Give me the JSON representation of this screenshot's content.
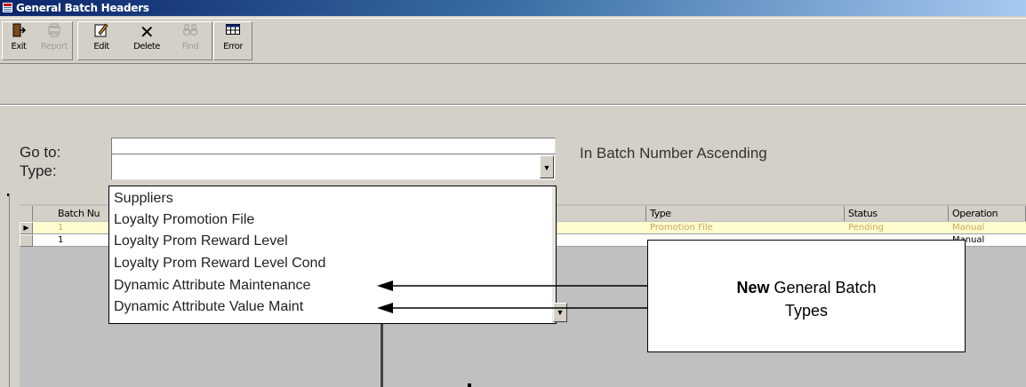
{
  "window": {
    "title": "General Batch Headers"
  },
  "toolbar": {
    "buttons": [
      {
        "label": "Exit",
        "icon": "exit-door-icon",
        "enabled": true
      },
      {
        "label": "Report",
        "icon": "report-icon",
        "enabled": false
      },
      {
        "label": "Edit",
        "icon": "edit-icon",
        "enabled": true
      },
      {
        "label": "Delete",
        "icon": "delete-x-icon",
        "enabled": true
      },
      {
        "label": "Find",
        "icon": "binoculars-icon",
        "enabled": false
      },
      {
        "label": "Error",
        "icon": "grid-icon",
        "enabled": true
      }
    ]
  },
  "form": {
    "goto_label": "Go to:",
    "goto_value": "",
    "sort_text": "In Batch Number Ascending",
    "type_label": "Type:",
    "type_value": ""
  },
  "type_dropdown": {
    "options": [
      "Suppliers",
      "Loyalty Promotion File",
      "Loyalty Prom Reward Level",
      "Loyalty Prom Reward Level Cond",
      "Dynamic Attribute Maintenance",
      "Dynamic Attribute Value Maint"
    ]
  },
  "grid": {
    "columns": [
      "Batch Nu",
      "Type",
      "Status",
      "Operation"
    ],
    "rows": [
      {
        "batch": "1",
        "type": "Promotion File",
        "status": "Pending",
        "operation": "Manual",
        "selected": true
      },
      {
        "batch": "1",
        "type": "",
        "status": "",
        "operation": "Manual",
        "selected": false
      }
    ]
  },
  "callout": {
    "bold": "New",
    "line1_rest": " General Batch",
    "line2": "Types"
  },
  "colors": {
    "title_bar": "#0a246a",
    "selected_row": "#fffccf",
    "selected_text": "#c8a860",
    "face": "#d4d0c8"
  }
}
